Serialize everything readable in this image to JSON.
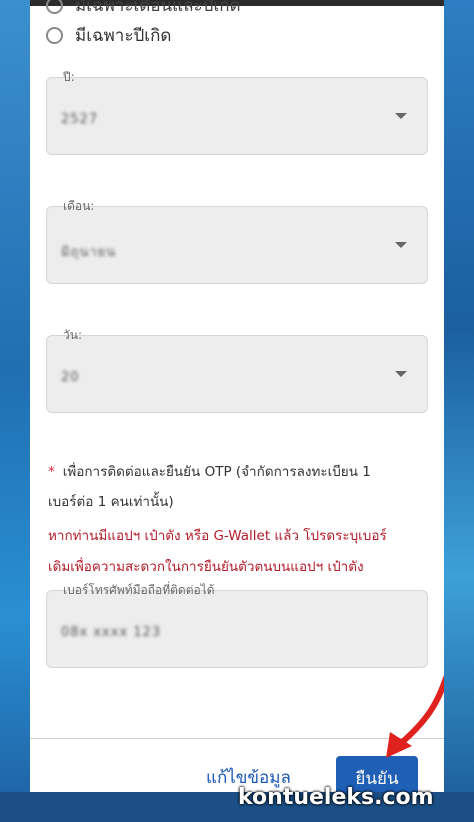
{
  "radio_options": {
    "partial_top": "มีเฉพาะเดือนและปีเกิด",
    "year_only": "มีเฉพาะปีเกิด"
  },
  "fields": {
    "year": {
      "label": "ปี:",
      "value": "2527"
    },
    "month": {
      "label": "เดือน:",
      "value": "มิถุนายน"
    },
    "day": {
      "label": "วัน:",
      "value": "20"
    },
    "phone": {
      "label": "เบอร์โทรศัพท์มือถือที่ติดต่อได้",
      "value": "08x xxxx 123"
    }
  },
  "notes": {
    "asterisk": "*",
    "line1": "เพื่อการติดต่อและยืนยัน OTP (จำกัดการลงทะเบียน 1",
    "line2": "เบอร์ต่อ 1 คนเท่านั้น)",
    "line3": "หากท่านมีแอปฯ เป๋าตัง หรือ G-Wallet แล้ว โปรดระบุเบอร์",
    "line4": "เดิมเพื่อความสะดวกในการยืนยันตัวตนบนแอปฯ เป๋าตัง"
  },
  "buttons": {
    "edit": "แก้ไขข้อมูล",
    "confirm": "ยืนยัน"
  },
  "watermark": "kontueleks.com",
  "colors": {
    "primary": "#1f5fb5",
    "warning_text": "#b31d2b",
    "arrow": "#e0221f"
  }
}
